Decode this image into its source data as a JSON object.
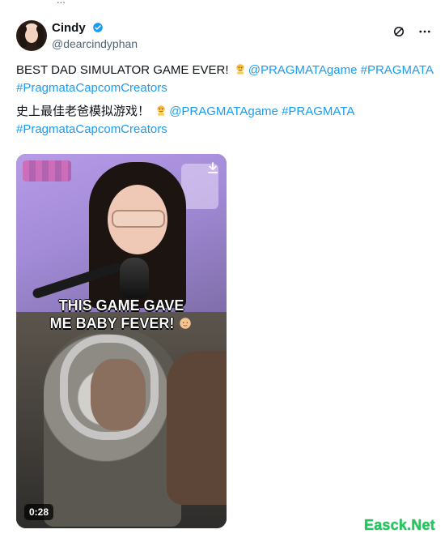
{
  "top_fragment": "...",
  "header": {
    "display_name": "Cindy",
    "handle": "@dearcindyphan"
  },
  "post": {
    "line1_text": "BEST DAD SIMULATOR GAME EVER!",
    "line1_mention": "@PRAGMATAgame",
    "line1_hashtag": "#PRAGMATA",
    "line1_hashtag2": "#PragmataCapcomCreators",
    "line2_text": "史上最佳老爸模拟游戏！",
    "line2_mention": "@PRAGMATAgame",
    "line2_hashtag": "#PRAGMATA",
    "line2_hashtag2": "#PragmataCapcomCreators"
  },
  "media": {
    "caption_line1": "THIS GAME GAVE",
    "caption_line2": "ME BABY FEVER!",
    "timecode": "0:28"
  },
  "watermark": {
    "text": "Easck.Net",
    "color": "#20c85d"
  },
  "icons": {
    "verified": "verified-badge-icon",
    "grok": "grok-icon",
    "more": "more-icon",
    "download": "download-icon"
  }
}
